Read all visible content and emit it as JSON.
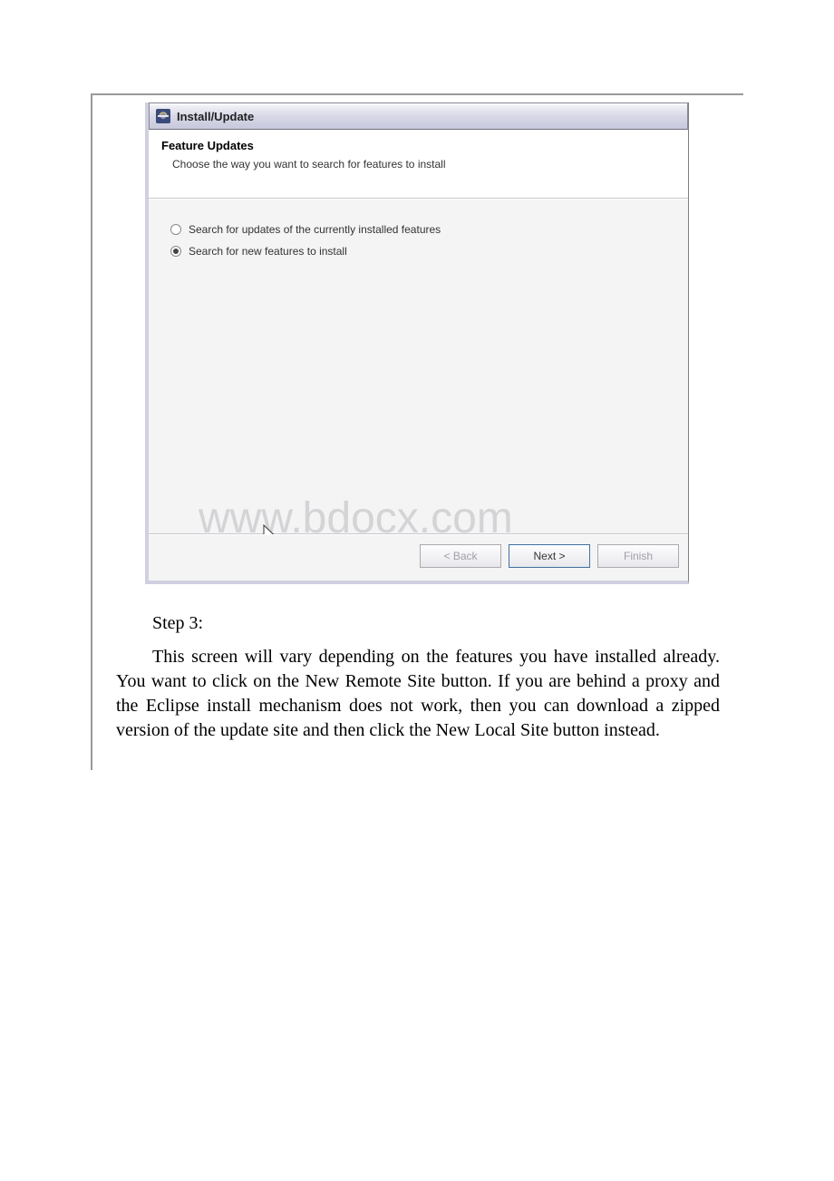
{
  "dialog": {
    "title": "Install/Update",
    "header": {
      "title": "Feature Updates",
      "description": "Choose the way you want to search for features to install"
    },
    "options": {
      "opt1": "Search for updates of the currently installed features",
      "opt2": "Search for new features to install"
    },
    "buttons": {
      "back": "< Back",
      "next": "Next >",
      "finish": "Finish"
    }
  },
  "watermark": "www.bdocx.com",
  "document": {
    "step_label": "Step 3:",
    "paragraph": "This screen will vary depending on the features you have installed already. You want to click on the New Remote Site button. If you are behind a proxy and the Eclipse install mechanism does not work, then you can download a zipped version of the update site and then click the New Local Site button instead."
  }
}
